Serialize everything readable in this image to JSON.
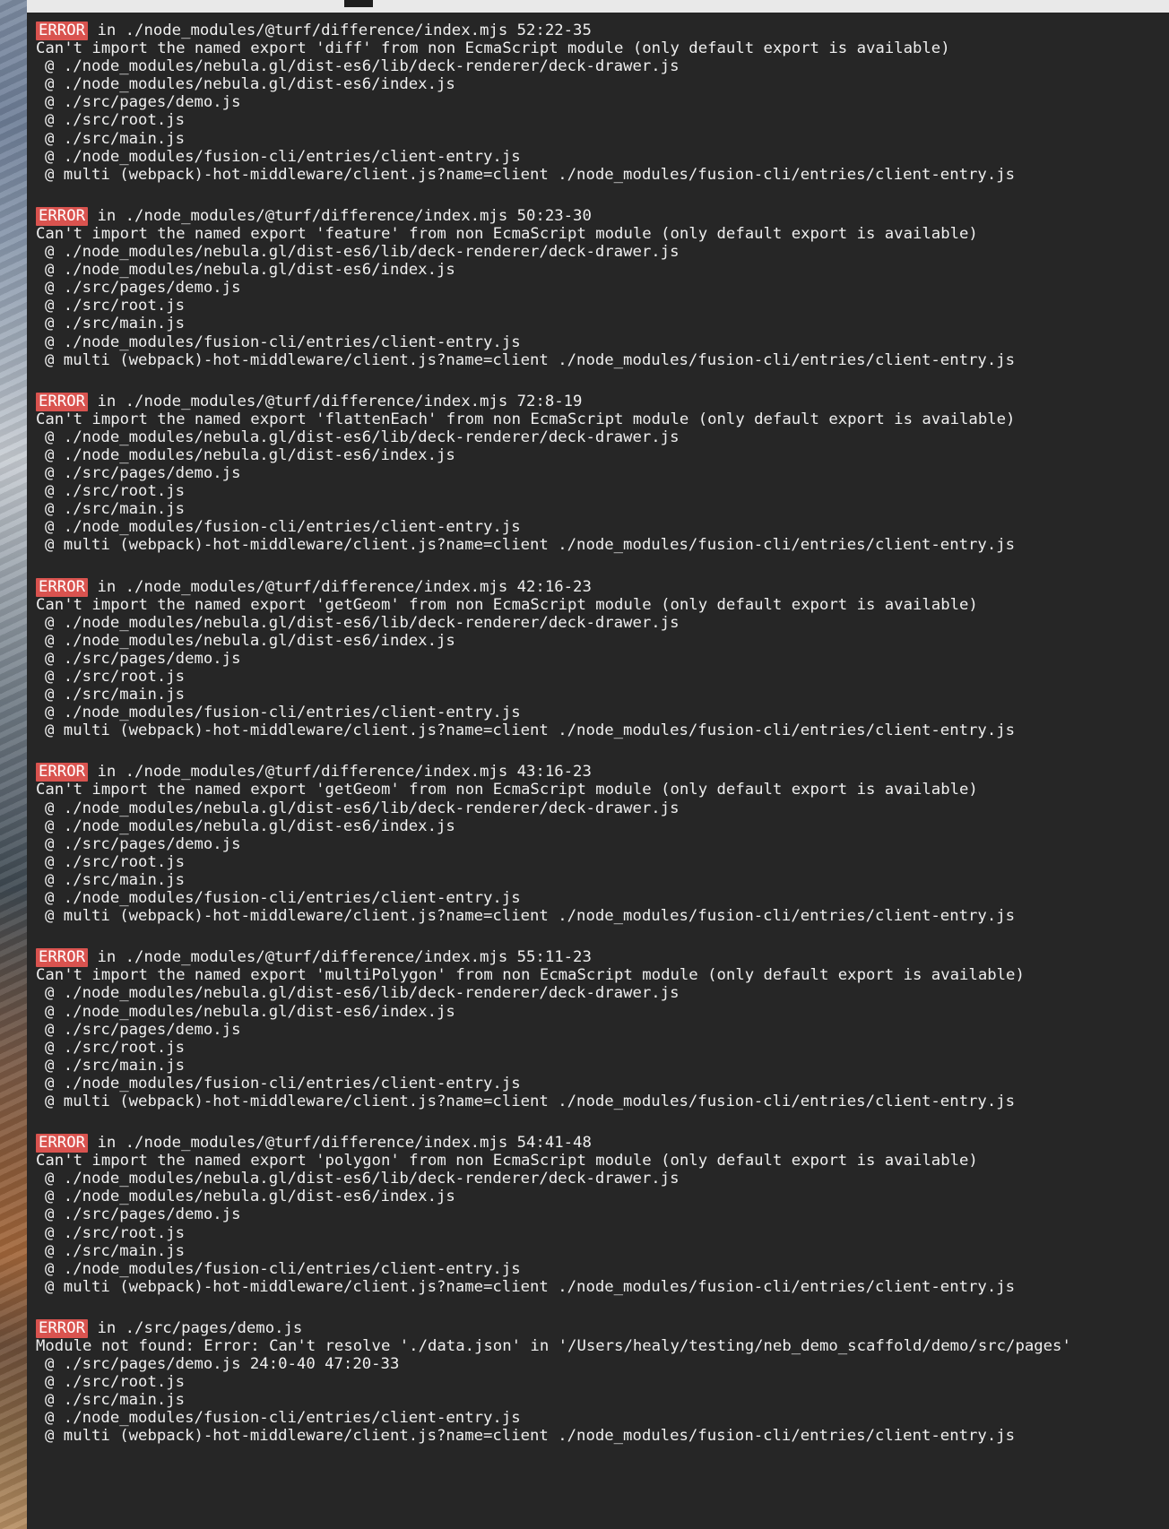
{
  "terminal": {
    "blocks": [
      {
        "badge": "ERROR",
        "location": "in ./node_modules/@turf/difference/index.mjs 52:22-35",
        "message": "Can't import the named export 'diff' from non EcmaScript module (only default export is available)",
        "trace": [
          "@ ./node_modules/nebula.gl/dist-es6/lib/deck-renderer/deck-drawer.js",
          "@ ./node_modules/nebula.gl/dist-es6/index.js",
          "@ ./src/pages/demo.js",
          "@ ./src/root.js",
          "@ ./src/main.js",
          "@ ./node_modules/fusion-cli/entries/client-entry.js",
          "@ multi (webpack)-hot-middleware/client.js?name=client ./node_modules/fusion-cli/entries/client-entry.js"
        ]
      },
      {
        "badge": "ERROR",
        "location": "in ./node_modules/@turf/difference/index.mjs 50:23-30",
        "message": "Can't import the named export 'feature' from non EcmaScript module (only default export is available)",
        "trace": [
          "@ ./node_modules/nebula.gl/dist-es6/lib/deck-renderer/deck-drawer.js",
          "@ ./node_modules/nebula.gl/dist-es6/index.js",
          "@ ./src/pages/demo.js",
          "@ ./src/root.js",
          "@ ./src/main.js",
          "@ ./node_modules/fusion-cli/entries/client-entry.js",
          "@ multi (webpack)-hot-middleware/client.js?name=client ./node_modules/fusion-cli/entries/client-entry.js"
        ]
      },
      {
        "badge": "ERROR",
        "location": "in ./node_modules/@turf/difference/index.mjs 72:8-19",
        "message": "Can't import the named export 'flattenEach' from non EcmaScript module (only default export is available)",
        "trace": [
          "@ ./node_modules/nebula.gl/dist-es6/lib/deck-renderer/deck-drawer.js",
          "@ ./node_modules/nebula.gl/dist-es6/index.js",
          "@ ./src/pages/demo.js",
          "@ ./src/root.js",
          "@ ./src/main.js",
          "@ ./node_modules/fusion-cli/entries/client-entry.js",
          "@ multi (webpack)-hot-middleware/client.js?name=client ./node_modules/fusion-cli/entries/client-entry.js"
        ]
      },
      {
        "badge": "ERROR",
        "location": "in ./node_modules/@turf/difference/index.mjs 42:16-23",
        "message": "Can't import the named export 'getGeom' from non EcmaScript module (only default export is available)",
        "trace": [
          "@ ./node_modules/nebula.gl/dist-es6/lib/deck-renderer/deck-drawer.js",
          "@ ./node_modules/nebula.gl/dist-es6/index.js",
          "@ ./src/pages/demo.js",
          "@ ./src/root.js",
          "@ ./src/main.js",
          "@ ./node_modules/fusion-cli/entries/client-entry.js",
          "@ multi (webpack)-hot-middleware/client.js?name=client ./node_modules/fusion-cli/entries/client-entry.js"
        ]
      },
      {
        "badge": "ERROR",
        "location": "in ./node_modules/@turf/difference/index.mjs 43:16-23",
        "message": "Can't import the named export 'getGeom' from non EcmaScript module (only default export is available)",
        "trace": [
          "@ ./node_modules/nebula.gl/dist-es6/lib/deck-renderer/deck-drawer.js",
          "@ ./node_modules/nebula.gl/dist-es6/index.js",
          "@ ./src/pages/demo.js",
          "@ ./src/root.js",
          "@ ./src/main.js",
          "@ ./node_modules/fusion-cli/entries/client-entry.js",
          "@ multi (webpack)-hot-middleware/client.js?name=client ./node_modules/fusion-cli/entries/client-entry.js"
        ]
      },
      {
        "badge": "ERROR",
        "location": "in ./node_modules/@turf/difference/index.mjs 55:11-23",
        "message": "Can't import the named export 'multiPolygon' from non EcmaScript module (only default export is available)",
        "trace": [
          "@ ./node_modules/nebula.gl/dist-es6/lib/deck-renderer/deck-drawer.js",
          "@ ./node_modules/nebula.gl/dist-es6/index.js",
          "@ ./src/pages/demo.js",
          "@ ./src/root.js",
          "@ ./src/main.js",
          "@ ./node_modules/fusion-cli/entries/client-entry.js",
          "@ multi (webpack)-hot-middleware/client.js?name=client ./node_modules/fusion-cli/entries/client-entry.js"
        ]
      },
      {
        "badge": "ERROR",
        "location": "in ./node_modules/@turf/difference/index.mjs 54:41-48",
        "message": "Can't import the named export 'polygon' from non EcmaScript module (only default export is available)",
        "trace": [
          "@ ./node_modules/nebula.gl/dist-es6/lib/deck-renderer/deck-drawer.js",
          "@ ./node_modules/nebula.gl/dist-es6/index.js",
          "@ ./src/pages/demo.js",
          "@ ./src/root.js",
          "@ ./src/main.js",
          "@ ./node_modules/fusion-cli/entries/client-entry.js",
          "@ multi (webpack)-hot-middleware/client.js?name=client ./node_modules/fusion-cli/entries/client-entry.js"
        ]
      },
      {
        "badge": "ERROR",
        "location": "in ./src/pages/demo.js",
        "message": "Module not found: Error: Can't resolve './data.json' in '/Users/healy/testing/neb_demo_scaffold/demo/src/pages'",
        "trace": [
          "@ ./src/pages/demo.js 24:0-40 47:20-33",
          "@ ./src/root.js",
          "@ ./src/main.js",
          "@ ./node_modules/fusion-cli/entries/client-entry.js",
          "@ multi (webpack)-hot-middleware/client.js?name=client ./node_modules/fusion-cli/entries/client-entry.js"
        ]
      }
    ]
  }
}
